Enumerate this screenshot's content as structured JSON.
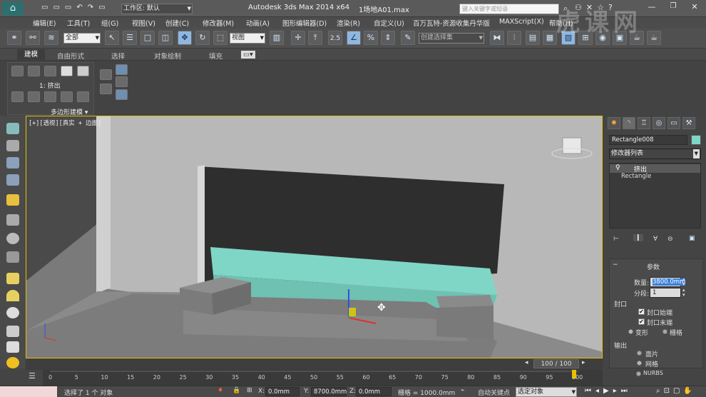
{
  "title": {
    "app": "Autodesk 3ds Max  2014 x64",
    "file": "1场地A01.max",
    "workspace": "工作区: 默认",
    "search_placeholder": "键入关键字或短语"
  },
  "menu": [
    "编辑(E)",
    "工具(T)",
    "组(G)",
    "视图(V)",
    "创建(C)",
    "修改器(M)",
    "动画(A)",
    "图形编辑器(D)",
    "渲染(R)",
    "自定义(U)",
    "百万瓦特-资源收集丹华版",
    "MAXScript(X)",
    "帮助(H)"
  ],
  "toolbar": {
    "filter": "全部",
    "refcoord": "视图",
    "snap_label": "2.5",
    "selset": "创建选择集"
  },
  "ribbon": {
    "tabs": [
      "建模",
      "自由形式",
      "选择",
      "对象绘制",
      "填充"
    ],
    "active_tab": "建模",
    "extrude_label": "1: 挤出",
    "group_label": "多边形建模 ▾"
  },
  "viewport": {
    "label": "[+][透视][真实 + 边面]"
  },
  "command_panel": {
    "object_name": "Rectangle008",
    "modifier_list": "修改器列表",
    "stack": [
      "挤出",
      "Rectangle"
    ],
    "rollout_title": "参数",
    "amount_label": "数量:",
    "amount_value": "3800.0mm",
    "segments_label": "分段:",
    "segments_value": "1",
    "cap_label": "封口",
    "cap_start": "封口始端",
    "cap_end": "封口末端",
    "morph": "变形",
    "grid": "栅格",
    "output_label": "输出",
    "out_patch": "面片",
    "out_mesh": "网格",
    "out_nurbs": "NURBS"
  },
  "timeline": {
    "position": "100 / 100",
    "ticks": [
      "0",
      "5",
      "10",
      "15",
      "20",
      "25",
      "30",
      "35",
      "40",
      "45",
      "50",
      "55",
      "60",
      "65",
      "70",
      "75",
      "80",
      "85",
      "90",
      "95",
      "100"
    ]
  },
  "status": {
    "selection": "选择了 1 个 对象",
    "x_label": "X:",
    "x": "0.0mm",
    "y_label": "Y:",
    "y": "8700.0mm",
    "z_label": "Z:",
    "z": "0.0mm",
    "grid": "栅格 = 1000.0mm",
    "autokey": "自动关键点",
    "key_mode": "选定对象"
  },
  "colors": {
    "accent": "#7fd6c6",
    "viewport_border": "#e2c200",
    "selection_blue": "#8fb7e0"
  },
  "watermark": "虎课网"
}
